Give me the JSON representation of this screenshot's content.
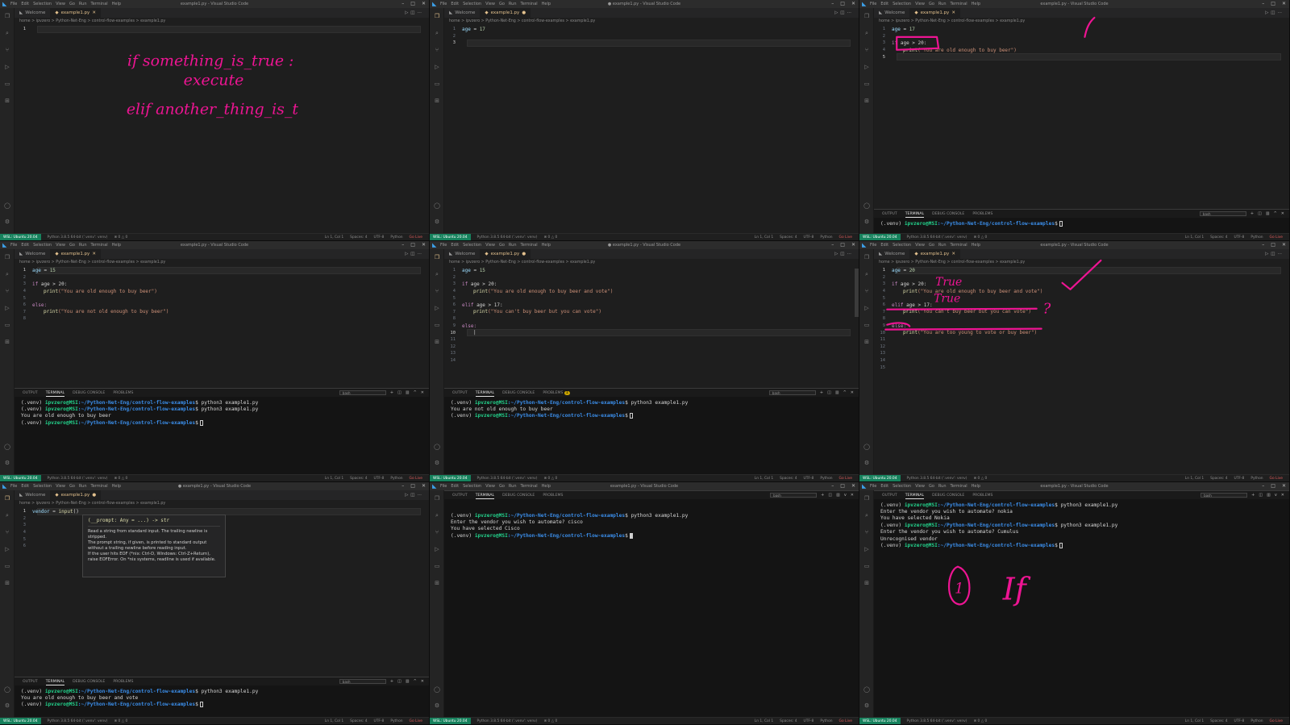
{
  "menu": [
    "File",
    "Edit",
    "Selection",
    "View",
    "Go",
    "Run",
    "Terminal",
    "Help"
  ],
  "window_title": "example1.py - Visual Studio Code",
  "window_title_dirty": "● example1.py - Visual Studio Code",
  "tabs": {
    "welcome": "Welcome",
    "file": "example1.py"
  },
  "breadcrumb": "home > ipvzero > Python-Net-Eng > control-flow-examples > example1.py",
  "panel_tabs": [
    "OUTPUT",
    "TERMINAL",
    "DEBUG CONSOLE",
    "PROBLEMS"
  ],
  "shell_label": "bash",
  "status": {
    "remote": "WSL: Ubuntu 20.04",
    "python": "Python 3.8.5 64-bit ('.venv': venv)",
    "problems": "⊗ 0 △ 0",
    "position": "Ln 1, Col 1",
    "spaces": "Spaces: 4",
    "encoding": "UTF-8",
    "eol": "LF",
    "language": "Python",
    "live": "Go Live"
  },
  "prompt": {
    "venv": "(.venv)",
    "user": "ipvzero@MSI",
    "path": ":~/Python-Net-Eng/control-flow-examples",
    "dollar": "$"
  },
  "panels": {
    "p1": {
      "code": [
        {
          "n": "1",
          "text": ""
        }
      ],
      "ink": {
        "l1": "if something_is_true :",
        "l2": "execute",
        "l3": "elif another_thing_is_t"
      }
    },
    "p2": {
      "code": [
        {
          "n": "1",
          "var": "age",
          "op": " = ",
          "num": "17"
        },
        {
          "n": "2",
          "text": ""
        },
        {
          "n": "3",
          "text": ""
        }
      ]
    },
    "p3": {
      "code": {
        "l1": {
          "n": "1",
          "var": "age",
          "op": " = ",
          "num": "17"
        },
        "l2": {
          "n": "2"
        },
        "l3": {
          "n": "3",
          "kw": "if",
          "cond": " age > 20:"
        },
        "l4": {
          "n": "4",
          "fn": "print",
          "str": "(\"You are old enough to buy beer\")"
        },
        "l5": {
          "n": "5"
        }
      },
      "terminal": []
    },
    "p4": {
      "code": {
        "age": "15",
        "if_cond": " age > 20:",
        "print1": "(\"You are old enough to buy beer\")",
        "else": "else:",
        "print2": "(\"You are not old enough to buy beer\")"
      },
      "terminal": [
        "python3 example1.py",
        "python3 example1.py",
        "You are old enough to buy beer"
      ]
    },
    "p5": {
      "code": {
        "age": "15",
        "if_cond": " age > 20:",
        "print1": "(\"You are old enough to buy beer and vote\")",
        "elif_cond": " age > 17:",
        "print2": "(\"You can't buy beer but you can vote\")",
        "else": "else:"
      },
      "terminal": [
        "python3 example1.py",
        "You are not old enough to buy beer"
      ],
      "problems_badge": "1"
    },
    "p6": {
      "code": {
        "age": "20",
        "if_cond": " age > 20:",
        "print1": "(\"You are old enough to buy beer and vote\")",
        "elif_cond": " age > 17:",
        "print2": "(\"You can't buy beer but you can vote\")",
        "else": "else:",
        "print3": "(\"You are too young to vote or buy beer\")"
      },
      "ink": {
        "t1": "True",
        "t2": "True",
        "q": "?"
      }
    },
    "p7": {
      "code": {
        "var": "vendor",
        "op": " = ",
        "fn": "input",
        "paren": "()"
      },
      "hover": {
        "sig": "(__prompt: Any = ...) -> str",
        "p1": "Read a string from standard input. The trailing newline is stripped.",
        "p2": "The prompt string, if given, is printed to standard output without a trailing newline before reading input.",
        "p3": "If the user hits EOF (*nix: Ctrl-D, Windows: Ctrl-Z+Return), raise EOFError. On *nix systems, readline is used if available."
      },
      "terminal": [
        "python3 example1.py",
        "You are old enough to buy beer and vote"
      ]
    },
    "p8": {
      "terminal": [
        "python3 example1.py",
        "Enter the vendor you wish to automate? cisco",
        "You have selected Cisco"
      ]
    },
    "p9": {
      "terminal": [
        "python3 example1.py",
        "Enter the vendor you wish to automate? nokia",
        "You have selected Nokia",
        "python3 example1.py",
        "Enter the vendor you wish to automate? Cumulus",
        "Unrecognised vendor"
      ],
      "ink": {
        "num": "1",
        "word": "If"
      }
    }
  }
}
